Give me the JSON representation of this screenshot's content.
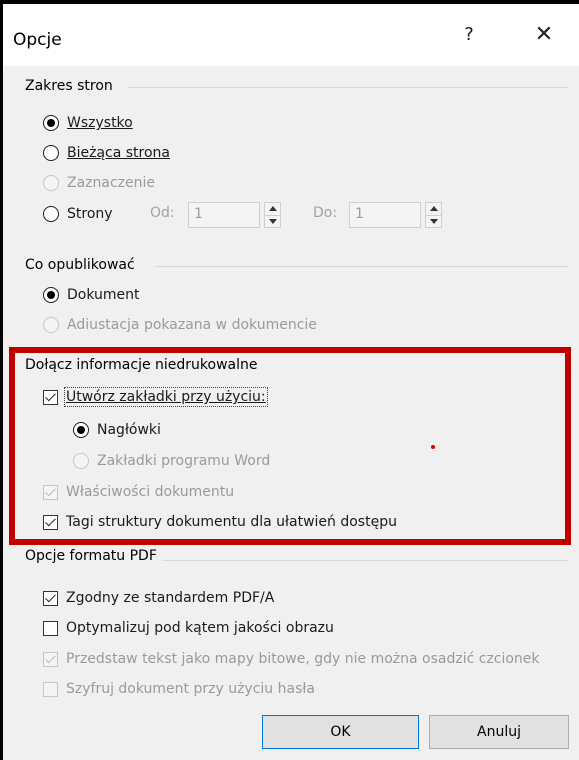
{
  "dialog": {
    "title": "Opcje",
    "help_label": "?",
    "close_label": "✕"
  },
  "page_range": {
    "label": "Zakres stron",
    "all": "Wszystko",
    "current": "Bieżąca strona",
    "selection": "Zaznaczenie",
    "pages": "Strony",
    "from_label": "Od:",
    "from_value": "1",
    "to_label": "Do:",
    "to_value": "1"
  },
  "publish": {
    "label": "Co opublikować",
    "document": "Dokument",
    "markup": "Adiustacja pokazana w dokumencie"
  },
  "nonprinting": {
    "label": "Dołącz informacje niedrukowalne",
    "create_bookmarks": "Utwórz zakładki przy użyciu:",
    "headings": "Nagłówki",
    "word_bookmarks": "Zakładki programu Word",
    "doc_properties": "Właściwości dokumentu",
    "structure_tags": "Tagi struktury dokumentu dla ułatwień dostępu"
  },
  "pdf": {
    "label": "Opcje formatu PDF",
    "pdfa": "Zgodny ze standardem PDF/A",
    "optimize": "Optymalizuj pod kątem jakości obrazu",
    "bitmap": "Przedstaw tekst jako mapy bitowe, gdy nie można osadzić czcionek",
    "encrypt": "Szyfruj dokument przy użyciu hasła"
  },
  "buttons": {
    "ok": "OK",
    "cancel": "Anuluj"
  },
  "colors": {
    "highlight": "#c00000",
    "accent": "#0078d7"
  }
}
